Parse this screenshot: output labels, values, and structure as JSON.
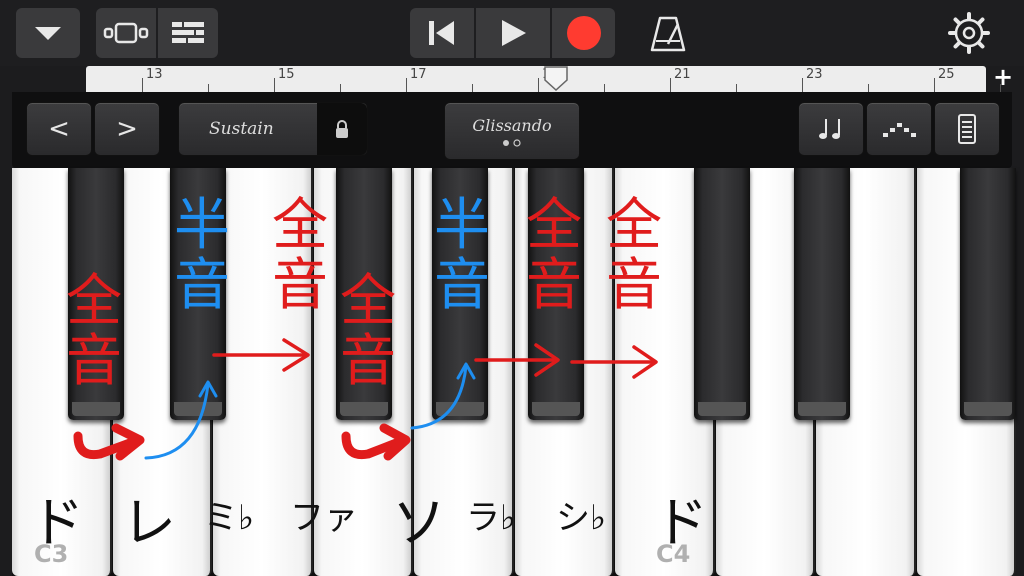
{
  "ruler": {
    "bars": [
      "13",
      "15",
      "17",
      "19",
      "21",
      "23",
      "25"
    ],
    "add_label": "+"
  },
  "controls": {
    "sustain_label": "Sustain",
    "glissando_label": "Glissando",
    "prev_label": "<",
    "next_label": ">"
  },
  "keyboard": {
    "note_names": [
      "ド",
      "レ",
      "ミ♭",
      "ファ",
      "ソ",
      "ラ♭",
      "シ♭",
      "ド"
    ],
    "octave_labels": [
      "C3",
      "C4"
    ]
  },
  "annotations": {
    "whole_step": "全音",
    "half_step": "半音",
    "whole_color": "#e01c1c",
    "half_color": "#1e8ef0"
  },
  "icons": {
    "menu": "chevron-down-icon",
    "tracks": "tracks-view-icon",
    "mixer": "list-view-icon",
    "rewind": "skip-back-icon",
    "play": "play-icon",
    "record": "record-icon",
    "metronome": "metronome-icon",
    "settings": "gear-icon",
    "lock": "lock-icon",
    "arpeggio": "note-pair-icon",
    "scale": "scale-dots-icon",
    "keyboard_size": "keyboard-size-icon"
  },
  "colors": {
    "record": "#ff3b30",
    "background": "#1c1c1e"
  }
}
